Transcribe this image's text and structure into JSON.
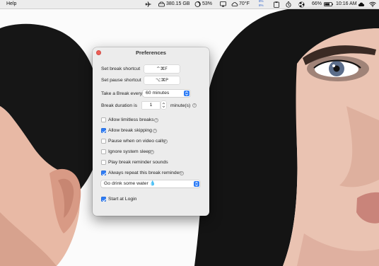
{
  "menubar": {
    "app_menu": "Help",
    "disk": "380.15 GB",
    "cpu": "53%",
    "temperature": "70°F",
    "memory_top": "8%",
    "memory_bottom": "8%",
    "battery": "66%",
    "clock": "10:16 AM"
  },
  "window": {
    "title": "Preferences",
    "set_break_shortcut_label": "Set break shortcut",
    "set_break_shortcut_value": "^⌘F",
    "set_pause_shortcut_label": "Set pause shortcut",
    "set_pause_shortcut_value": "⌥⌘P",
    "take_break_label": "Take a Break every",
    "take_break_value": "60 minutes",
    "break_duration_label": "Break duration is",
    "break_duration_value": "1",
    "break_duration_unit": "minute(s)",
    "checkboxes": [
      {
        "label": "Allow limitless breaks",
        "checked": false
      },
      {
        "label": "Allow break skipping",
        "checked": true
      },
      {
        "label": "Pause when on video calls",
        "checked": false
      },
      {
        "label": "Ignore system sleep",
        "checked": false
      },
      {
        "label": "Play break reminder sounds",
        "checked": false
      },
      {
        "label": "Always repeat this break reminder:",
        "checked": true
      }
    ],
    "reminder_value": "Go drink some water 💧",
    "start_at_login_label": "Start at Login",
    "start_at_login_checked": true
  },
  "colors": {
    "accent": "#2d7cf6",
    "close": "#ee5f57",
    "window_bg": "#ececec"
  }
}
